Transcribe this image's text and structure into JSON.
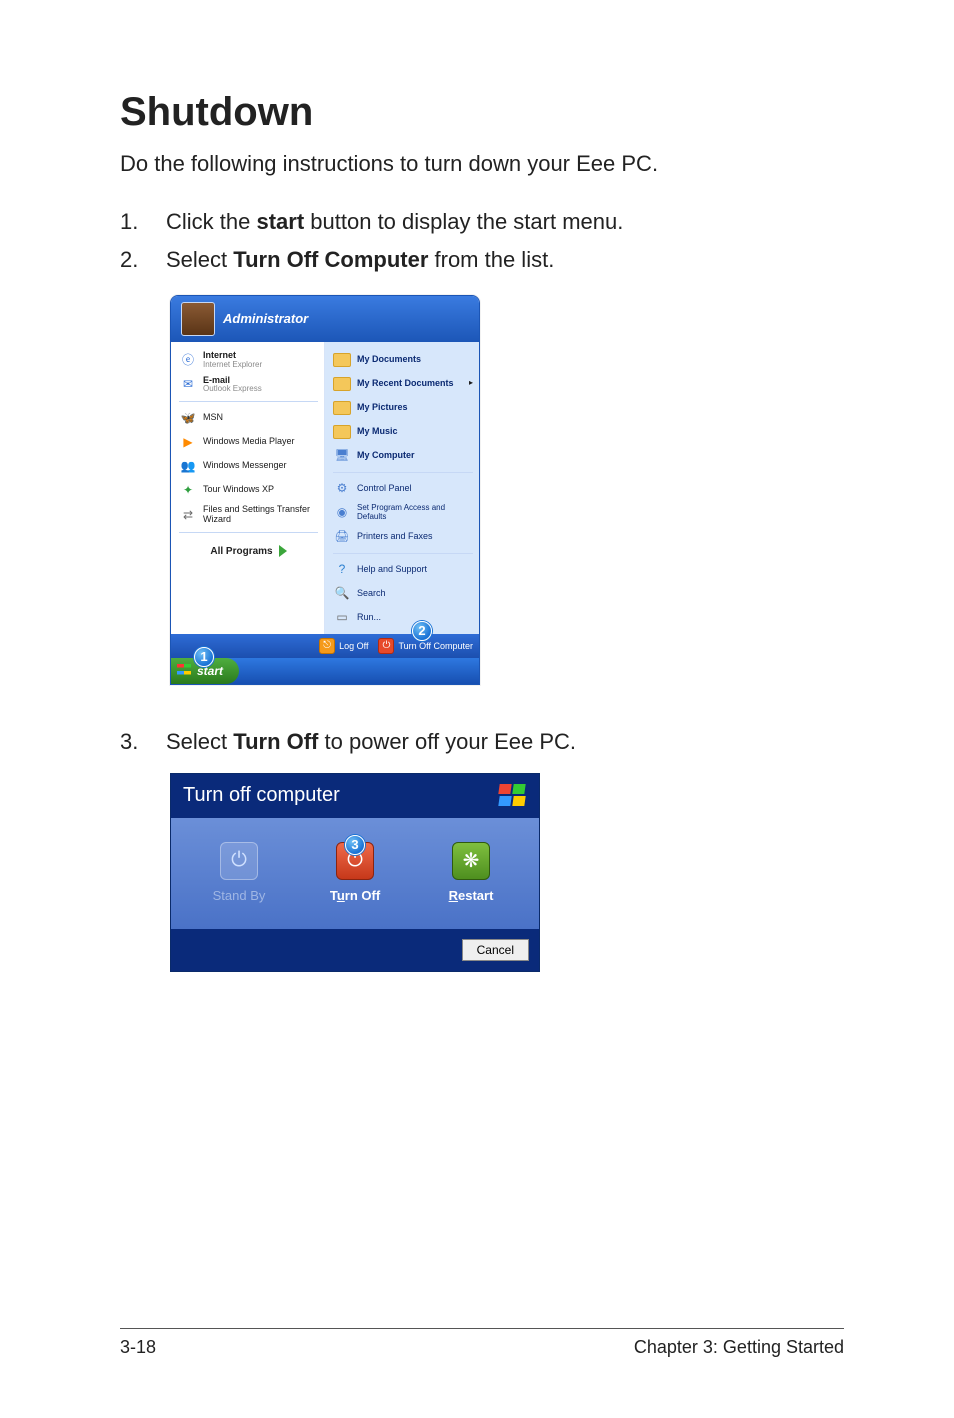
{
  "heading": "Shutdown",
  "intro": "Do the following instructions to turn down your Eee PC.",
  "steps": {
    "s1": {
      "num": "1.",
      "pre": "Click the ",
      "b": "start",
      "post": " button to display the start menu."
    },
    "s2": {
      "num": "2.",
      "pre": "Select ",
      "b": "Turn Off Computer",
      "post": " from the list."
    },
    "s3": {
      "num": "3.",
      "pre": "Select ",
      "b": "Turn Off",
      "post": " to power off your Eee PC."
    }
  },
  "callouts": {
    "c1": "1",
    "c2": "2",
    "c3": "3"
  },
  "startmenu": {
    "user": "Administrator",
    "left": {
      "internet_label": "Internet",
      "internet_sub": "Internet Explorer",
      "email_label": "E-mail",
      "email_sub": "Outlook Express",
      "msn": "MSN",
      "wmp": "Windows Media Player",
      "wm": "Windows Messenger",
      "tour": "Tour Windows XP",
      "fst": "Files and Settings Transfer Wizard",
      "allprograms": "All Programs"
    },
    "right": {
      "mydocs": "My Documents",
      "recent": "My Recent Documents",
      "recent_arrow": "▸",
      "mypics": "My Pictures",
      "mymusic": "My Music",
      "mycomp": "My Computer",
      "cpanel": "Control Panel",
      "spad": "Set Program Access and Defaults",
      "printers": "Printers and Faxes",
      "help": "Help and Support",
      "search": "Search",
      "run": "Run..."
    },
    "footer": {
      "logoff": "Log Off",
      "turnoff": "Turn Off Computer"
    },
    "start": "start"
  },
  "turn_off_dialog": {
    "title": "Turn off computer",
    "standby": "Stand By",
    "turnoff": "Turn Off",
    "restart": "Restart",
    "cancel": "Cancel",
    "underline": {
      "turnoff_u": "u",
      "restart_r": "R"
    }
  },
  "footer": {
    "left": "3-18",
    "right": "Chapter 3: Getting Started"
  }
}
